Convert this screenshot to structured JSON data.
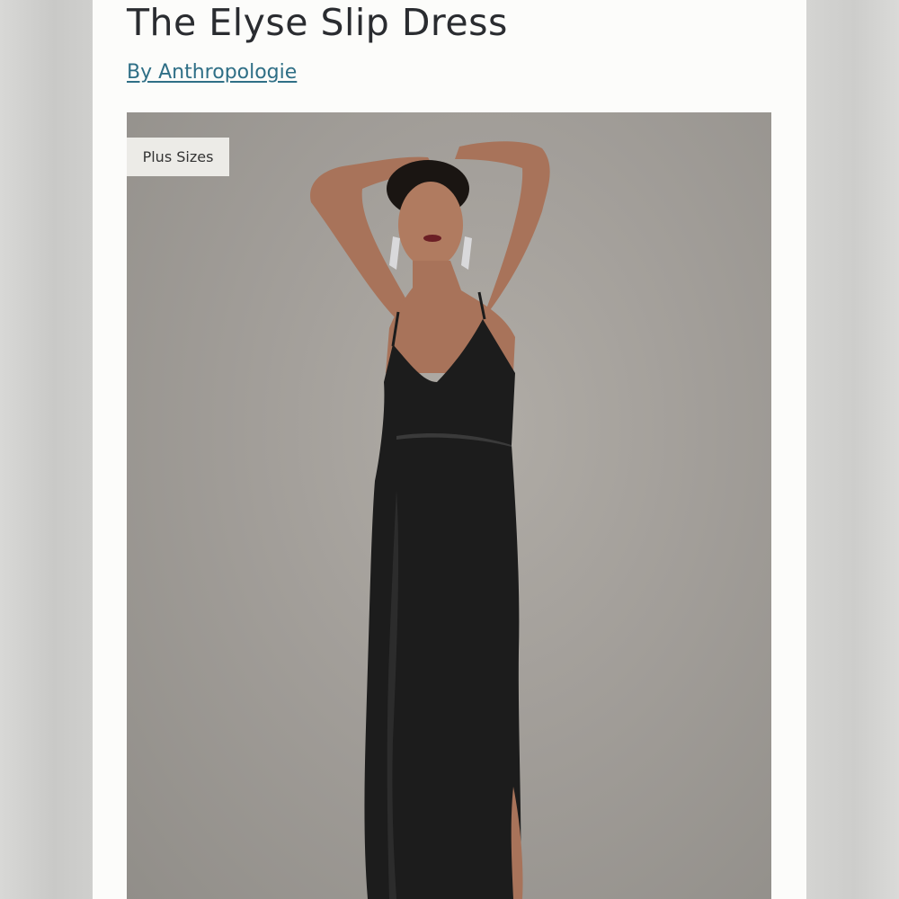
{
  "product": {
    "title": "The Elyse Slip Dress",
    "brand_link": "By Anthropologie"
  },
  "image": {
    "badge": "Plus Sizes",
    "background_color": "#a29e99",
    "dress_color": "#1c1c1c"
  },
  "colors": {
    "link": "#2f6f86",
    "title": "#2a2c30",
    "page_background": "#fcfcfa"
  }
}
